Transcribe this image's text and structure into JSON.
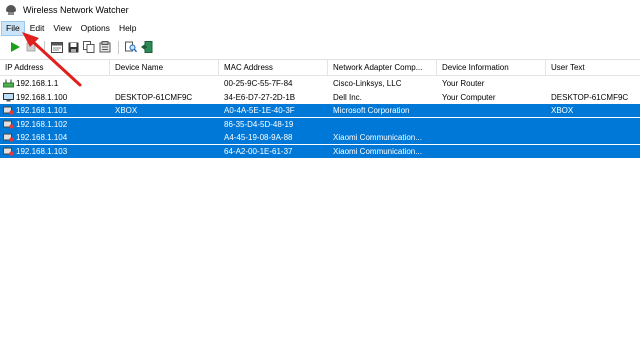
{
  "window": {
    "title": "Wireless Network Watcher"
  },
  "menu": [
    "File",
    "Edit",
    "View",
    "Options",
    "Help"
  ],
  "toolbar": {
    "buttons": [
      "play-icon",
      "stop-icon",
      "html-report-icon",
      "save-icon",
      "copy-icon",
      "properties-icon",
      "find-icon",
      "exit-icon"
    ]
  },
  "columns": [
    "IP Address",
    "Device Name",
    "MAC Address",
    "Network Adapter Comp...",
    "Device Information",
    "User Text"
  ],
  "rows": [
    {
      "ip": "192.168.1.1",
      "device": "",
      "mac": "00-25-9C-55-7F-84",
      "adapter": "Cisco-Linksys, LLC",
      "info": "Your Router",
      "user": "",
      "selected": false,
      "icon": "router"
    },
    {
      "ip": "192.168.1.100",
      "device": "DESKTOP-61CMF9C",
      "mac": "34-E6-D7-27-2D-1B",
      "adapter": "Dell Inc.",
      "info": "Your Computer",
      "user": "DESKTOP-61CMF9C",
      "selected": false,
      "icon": "computer"
    },
    {
      "ip": "192.168.1.101",
      "device": "XBOX",
      "mac": "A0-4A-5E-1E-40-3F",
      "adapter": "Microsoft Corporation",
      "info": "",
      "user": "XBOX",
      "selected": true,
      "icon": "device"
    },
    {
      "ip": "192.168.1.102",
      "device": "",
      "mac": "86-35-D4-5D-48-19",
      "adapter": "",
      "info": "",
      "user": "",
      "selected": true,
      "icon": "device"
    },
    {
      "ip": "192.168.1.104",
      "device": "",
      "mac": "A4-45-19-08-9A-88",
      "adapter": "Xiaomi Communication...",
      "info": "",
      "user": "",
      "selected": true,
      "icon": "device"
    },
    {
      "ip": "192.168.1.103",
      "device": "",
      "mac": "64-A2-00-1E-61-37",
      "adapter": "Xiaomi Communication...",
      "info": "",
      "user": "",
      "selected": true,
      "icon": "device"
    }
  ],
  "colors": {
    "selection": "#0078d7",
    "menu_highlight": "#cce4f7",
    "arrow": "#e0201c",
    "play": "#1aa01a"
  }
}
